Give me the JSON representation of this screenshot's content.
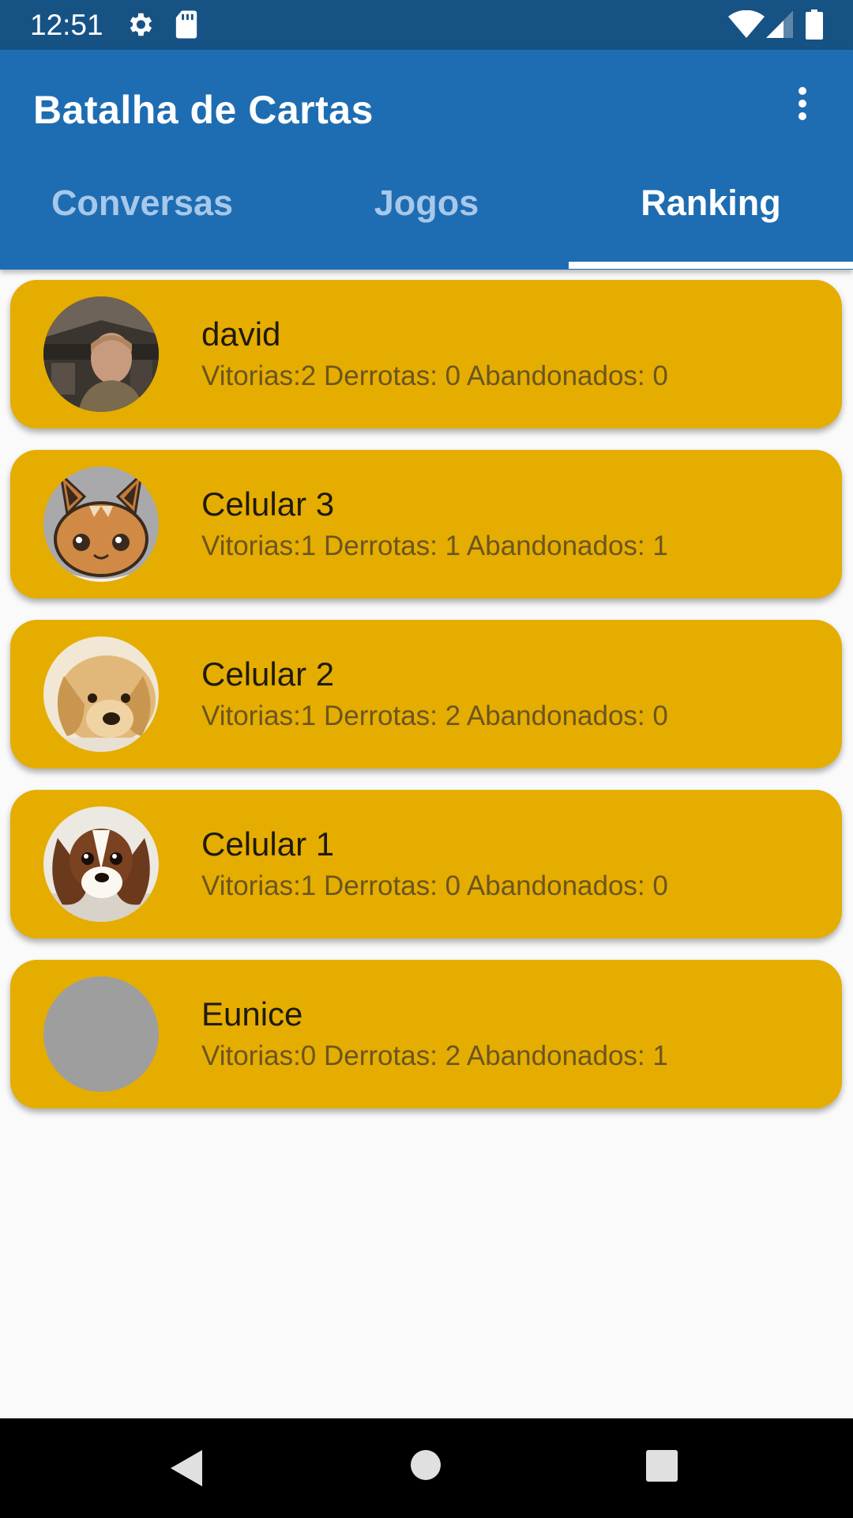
{
  "status_bar": {
    "time": "12:51",
    "icons": [
      "gear-icon",
      "sd-card-icon",
      "wifi-icon",
      "cell-signal-icon",
      "battery-icon"
    ]
  },
  "app_bar": {
    "title": "Batalha de Cartas",
    "menu_icon": "more-vert-icon",
    "tabs": [
      {
        "label": "Conversas",
        "active": false
      },
      {
        "label": "Jogos",
        "active": false
      },
      {
        "label": "Ranking",
        "active": true
      }
    ]
  },
  "ranking": [
    {
      "name": "david",
      "stats": "Vitorias:2 Derrotas: 0 Abandonados: 0",
      "avatar": "man-photo"
    },
    {
      "name": "Celular 3",
      "stats": "Vitorias:1 Derrotas: 1 Abandonados: 1",
      "avatar": "cartoon-fox"
    },
    {
      "name": "Celular 2",
      "stats": "Vitorias:1 Derrotas: 2 Abandonados: 0",
      "avatar": "golden-puppy"
    },
    {
      "name": "Celular 1",
      "stats": "Vitorias:1 Derrotas: 0 Abandonados: 0",
      "avatar": "spaniel-dog"
    },
    {
      "name": "Eunice",
      "stats": "Vitorias:0 Derrotas: 2 Abandonados: 1",
      "avatar": "placeholder"
    }
  ],
  "nav_bar": {
    "icons": [
      "back-icon",
      "home-icon",
      "recents-icon"
    ]
  },
  "colors": {
    "status_bar": "#175285",
    "app_bar": "#1e6db2",
    "card": "#e5ad00",
    "background": "#fafafa",
    "tab_inactive": "#a7c8ea"
  }
}
